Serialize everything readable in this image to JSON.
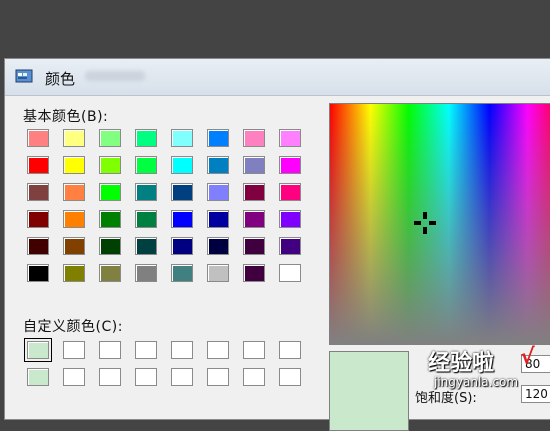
{
  "window": {
    "title": "颜色",
    "icon": "palette-icon"
  },
  "basic_colors": {
    "label": "基本颜色(B):",
    "rows": [
      [
        "#ff8080",
        "#ffff80",
        "#80ff80",
        "#00ff80",
        "#80ffff",
        "#0080ff",
        "#ff80c0",
        "#ff80ff"
      ],
      [
        "#ff0000",
        "#ffff00",
        "#80ff00",
        "#00ff40",
        "#00ffff",
        "#0080c0",
        "#8080c0",
        "#ff00ff"
      ],
      [
        "#804040",
        "#ff8040",
        "#00ff00",
        "#008080",
        "#004080",
        "#8080ff",
        "#800040",
        "#ff0080"
      ],
      [
        "#800000",
        "#ff8000",
        "#008000",
        "#008040",
        "#0000ff",
        "#0000a0",
        "#800080",
        "#8000ff"
      ],
      [
        "#400000",
        "#804000",
        "#004000",
        "#004040",
        "#000080",
        "#000040",
        "#400040",
        "#400080"
      ],
      [
        "#000000",
        "#808000",
        "#808040",
        "#808080",
        "#408080",
        "#c0c0c0",
        "#400040",
        "#ffffff"
      ]
    ]
  },
  "custom_colors": {
    "label": "自定义颜色(C):",
    "rows": [
      [
        "#c9e8cc",
        "#ffffff",
        "#ffffff",
        "#ffffff",
        "#ffffff",
        "#ffffff",
        "#ffffff",
        "#ffffff"
      ],
      [
        "#c9e8cc",
        "#ffffff",
        "#ffffff",
        "#ffffff",
        "#ffffff",
        "#ffffff",
        "#ffffff",
        "#ffffff"
      ]
    ]
  },
  "preview_color": "#c9e8cc",
  "fields": {
    "value_1": "80",
    "saturation_label": "饱和度(S):",
    "saturation_value": "120"
  },
  "watermark": {
    "main": "经验啦",
    "check": "√",
    "url": "jingyanla.com"
  }
}
